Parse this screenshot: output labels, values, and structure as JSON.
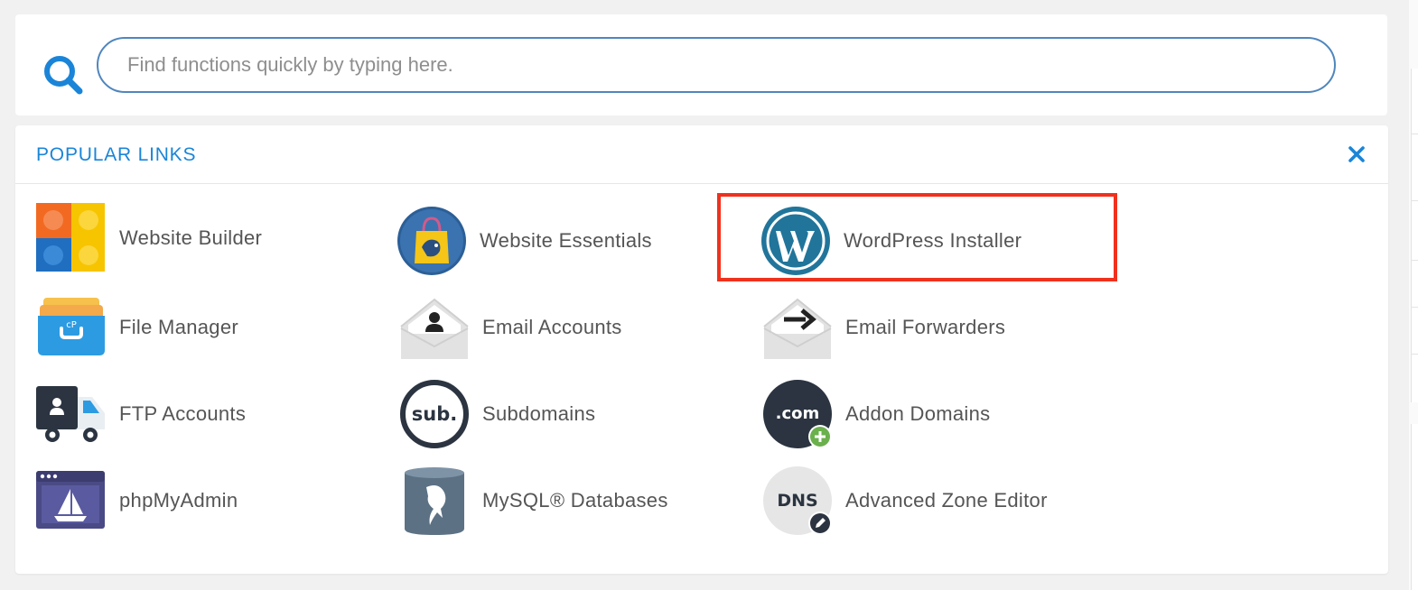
{
  "search": {
    "placeholder": "Find functions quickly by typing here.",
    "value": ""
  },
  "popular_links": {
    "title": "POPULAR LINKS",
    "items": [
      {
        "label": "Website Builder",
        "icon": "website-builder-icon"
      },
      {
        "label": "Website Essentials",
        "icon": "website-essentials-icon"
      },
      {
        "label": "WordPress Installer",
        "icon": "wordpress-icon",
        "highlighted": true
      },
      {
        "label": "File Manager",
        "icon": "file-manager-icon"
      },
      {
        "label": "Email Accounts",
        "icon": "email-accounts-icon"
      },
      {
        "label": "Email Forwarders",
        "icon": "email-forwarders-icon"
      },
      {
        "label": "FTP Accounts",
        "icon": "ftp-accounts-icon"
      },
      {
        "label": "Subdomains",
        "icon": "subdomains-icon"
      },
      {
        "label": "Addon Domains",
        "icon": "addon-domains-icon"
      },
      {
        "label": "phpMyAdmin",
        "icon": "phpmyadmin-icon"
      },
      {
        "label": "MySQL® Databases",
        "icon": "mysql-databases-icon"
      },
      {
        "label": "Advanced Zone Editor",
        "icon": "zone-editor-icon"
      }
    ],
    "icon_text": {
      "sub": "sub.",
      "com": ".com",
      "dns": "DNS"
    }
  },
  "colors": {
    "accent": "#1a85d8",
    "search_border": "#4f86bd",
    "highlight": "#f0311d",
    "label_text": "#555555"
  }
}
